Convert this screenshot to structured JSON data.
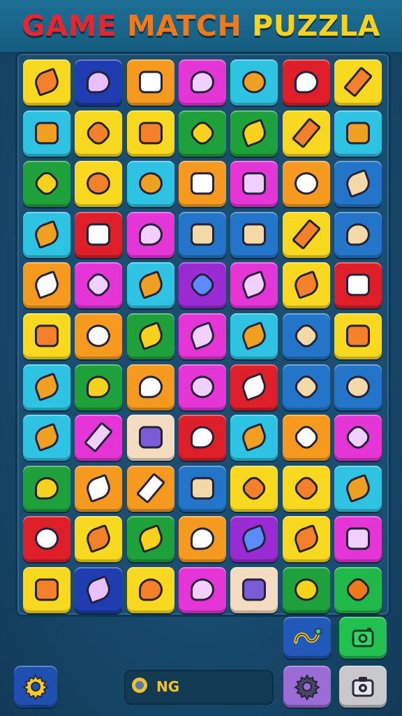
{
  "header": {
    "title_words": [
      "GAME",
      "MATCH",
      "PUZZLA"
    ]
  },
  "palette": {
    "yellow": "#f9d91f",
    "navy": "#1f3db0",
    "orange": "#f59a1f",
    "magenta": "#e535d6",
    "cyan": "#2fc3e3",
    "red": "#de1f2a",
    "green": "#1ea13a",
    "purple": "#9a2ad2",
    "peach": "#f3dcc2",
    "blue": "#2275c8",
    "lime": "#21b84a",
    "violet": "#a56fd8",
    "grey": "#c8c8cc"
  },
  "grid": {
    "rows": 11,
    "cols": 7,
    "tiles": [
      [
        {
          "color": "yellow",
          "icon": "sun-icon"
        },
        {
          "color": "navy",
          "icon": "eraser-icon"
        },
        {
          "color": "orange",
          "icon": "parking-sign-icon"
        },
        {
          "color": "magenta",
          "icon": "eraser-icon"
        },
        {
          "color": "cyan",
          "icon": "rocket-icon"
        },
        {
          "color": "red",
          "icon": "speech-bubble-icon"
        },
        {
          "color": "yellow",
          "icon": "wrench-icon"
        }
      ],
      [
        {
          "color": "cyan",
          "icon": "bag-icon"
        },
        {
          "color": "yellow",
          "icon": "battery-icon"
        },
        {
          "color": "yellow",
          "icon": "leaf-icon"
        },
        {
          "color": "green",
          "icon": "fish-icon"
        },
        {
          "color": "green",
          "icon": "pencil-icon"
        },
        {
          "color": "yellow",
          "icon": "stapler-icon"
        },
        {
          "color": "cyan",
          "icon": "roller-icon"
        }
      ],
      [
        {
          "color": "green",
          "icon": "map-pin-icon"
        },
        {
          "color": "yellow",
          "icon": "suitcase-icon"
        },
        {
          "color": "cyan",
          "icon": "leaves-icon"
        },
        {
          "color": "orange",
          "icon": "dial-icon"
        },
        {
          "color": "magenta",
          "icon": "pen-icon"
        },
        {
          "color": "orange",
          "icon": "house-icon"
        },
        {
          "color": "blue",
          "icon": "brush-icon"
        }
      ],
      [
        {
          "color": "cyan",
          "icon": "book-icon"
        },
        {
          "color": "red",
          "icon": "globe-icon"
        },
        {
          "color": "magenta",
          "icon": "flower-icon"
        },
        {
          "color": "blue",
          "icon": "ring-icon"
        },
        {
          "color": "blue",
          "icon": "bean-icon"
        },
        {
          "color": "yellow",
          "icon": "flower-bouquet-icon"
        },
        {
          "color": "blue",
          "icon": "folder-icon"
        }
      ],
      [
        {
          "color": "orange",
          "icon": "book-icon"
        },
        {
          "color": "magenta",
          "icon": "checkmark-icon"
        },
        {
          "color": "cyan",
          "icon": "pencil-icon"
        },
        {
          "color": "purple",
          "icon": "crosshair-icon"
        },
        {
          "color": "magenta",
          "icon": "planet-icon"
        },
        {
          "color": "yellow",
          "icon": "pencil-icon"
        },
        {
          "color": "red",
          "icon": "radio-icon"
        }
      ],
      [
        {
          "color": "yellow",
          "icon": "bag-icon"
        },
        {
          "color": "orange",
          "icon": "tv-icon"
        },
        {
          "color": "green",
          "icon": "checkbox-icon"
        },
        {
          "color": "magenta",
          "icon": "gear-icon"
        },
        {
          "color": "cyan",
          "icon": "map-icon"
        },
        {
          "color": "blue",
          "icon": "ticket-icon"
        },
        {
          "color": "yellow",
          "icon": "box-icon"
        }
      ],
      [
        {
          "color": "cyan",
          "icon": "pencil-icon"
        },
        {
          "color": "green",
          "icon": "counter-icon"
        },
        {
          "color": "orange",
          "icon": "speech-bubble-icon"
        },
        {
          "color": "magenta",
          "icon": "card-icon"
        },
        {
          "color": "red",
          "icon": "sun-icon"
        },
        {
          "color": "blue",
          "icon": "star-icon"
        },
        {
          "color": "blue",
          "icon": "rectangle-icon"
        }
      ],
      [
        {
          "color": "cyan",
          "icon": "remote-icon"
        },
        {
          "color": "magenta",
          "icon": "blob-icon"
        },
        {
          "color": "peach",
          "icon": "lens-icon"
        },
        {
          "color": "red",
          "icon": "heart-icon"
        },
        {
          "color": "cyan",
          "icon": "search-icon"
        },
        {
          "color": "orange",
          "icon": "wheel-icon"
        },
        {
          "color": "magenta",
          "icon": "ribbon-icon"
        }
      ],
      [
        {
          "color": "green",
          "icon": "folder-icon"
        },
        {
          "color": "orange",
          "icon": "sun-icon"
        },
        {
          "color": "orange",
          "icon": "key-icon"
        },
        {
          "color": "blue",
          "icon": "bean-icon"
        },
        {
          "color": "yellow",
          "icon": "fish-icon"
        },
        {
          "color": "yellow",
          "icon": "fish-icon"
        },
        {
          "color": "cyan",
          "icon": "starfish-icon"
        }
      ],
      [
        {
          "color": "red",
          "icon": "suitcase-icon"
        },
        {
          "color": "yellow",
          "icon": "lemon-icon"
        },
        {
          "color": "green",
          "icon": "bear-icon"
        },
        {
          "color": "orange",
          "icon": "heart-icon"
        },
        {
          "color": "purple",
          "icon": "syringe-icon"
        },
        {
          "color": "yellow",
          "icon": "gear-icon"
        },
        {
          "color": "magenta",
          "icon": "swirl-icon"
        }
      ],
      [
        {
          "color": "yellow",
          "icon": "leaf-icon"
        },
        {
          "color": "navy",
          "icon": "tablet-icon"
        },
        {
          "color": "yellow",
          "icon": "hook-icon"
        },
        {
          "color": "magenta",
          "icon": "splat-icon"
        },
        {
          "color": "peach",
          "icon": "bean-icon"
        },
        {
          "color": "green",
          "icon": "card-icon"
        },
        {
          "color": "lime",
          "icon": "star-icon"
        }
      ]
    ]
  },
  "controls": {
    "settings_icon": "gear-icon",
    "status_text": "NG",
    "status_icon": "coin-icon",
    "side_buttons": [
      {
        "name": "swap-button",
        "icon": "swap-icon",
        "color": "blue"
      },
      {
        "name": "photo-button",
        "icon": "photo-icon",
        "color": "lime"
      },
      {
        "name": "options-button",
        "icon": "gear-icon",
        "color": "violet"
      },
      {
        "name": "camera-button",
        "icon": "camera-icon",
        "color": "grey"
      }
    ]
  }
}
